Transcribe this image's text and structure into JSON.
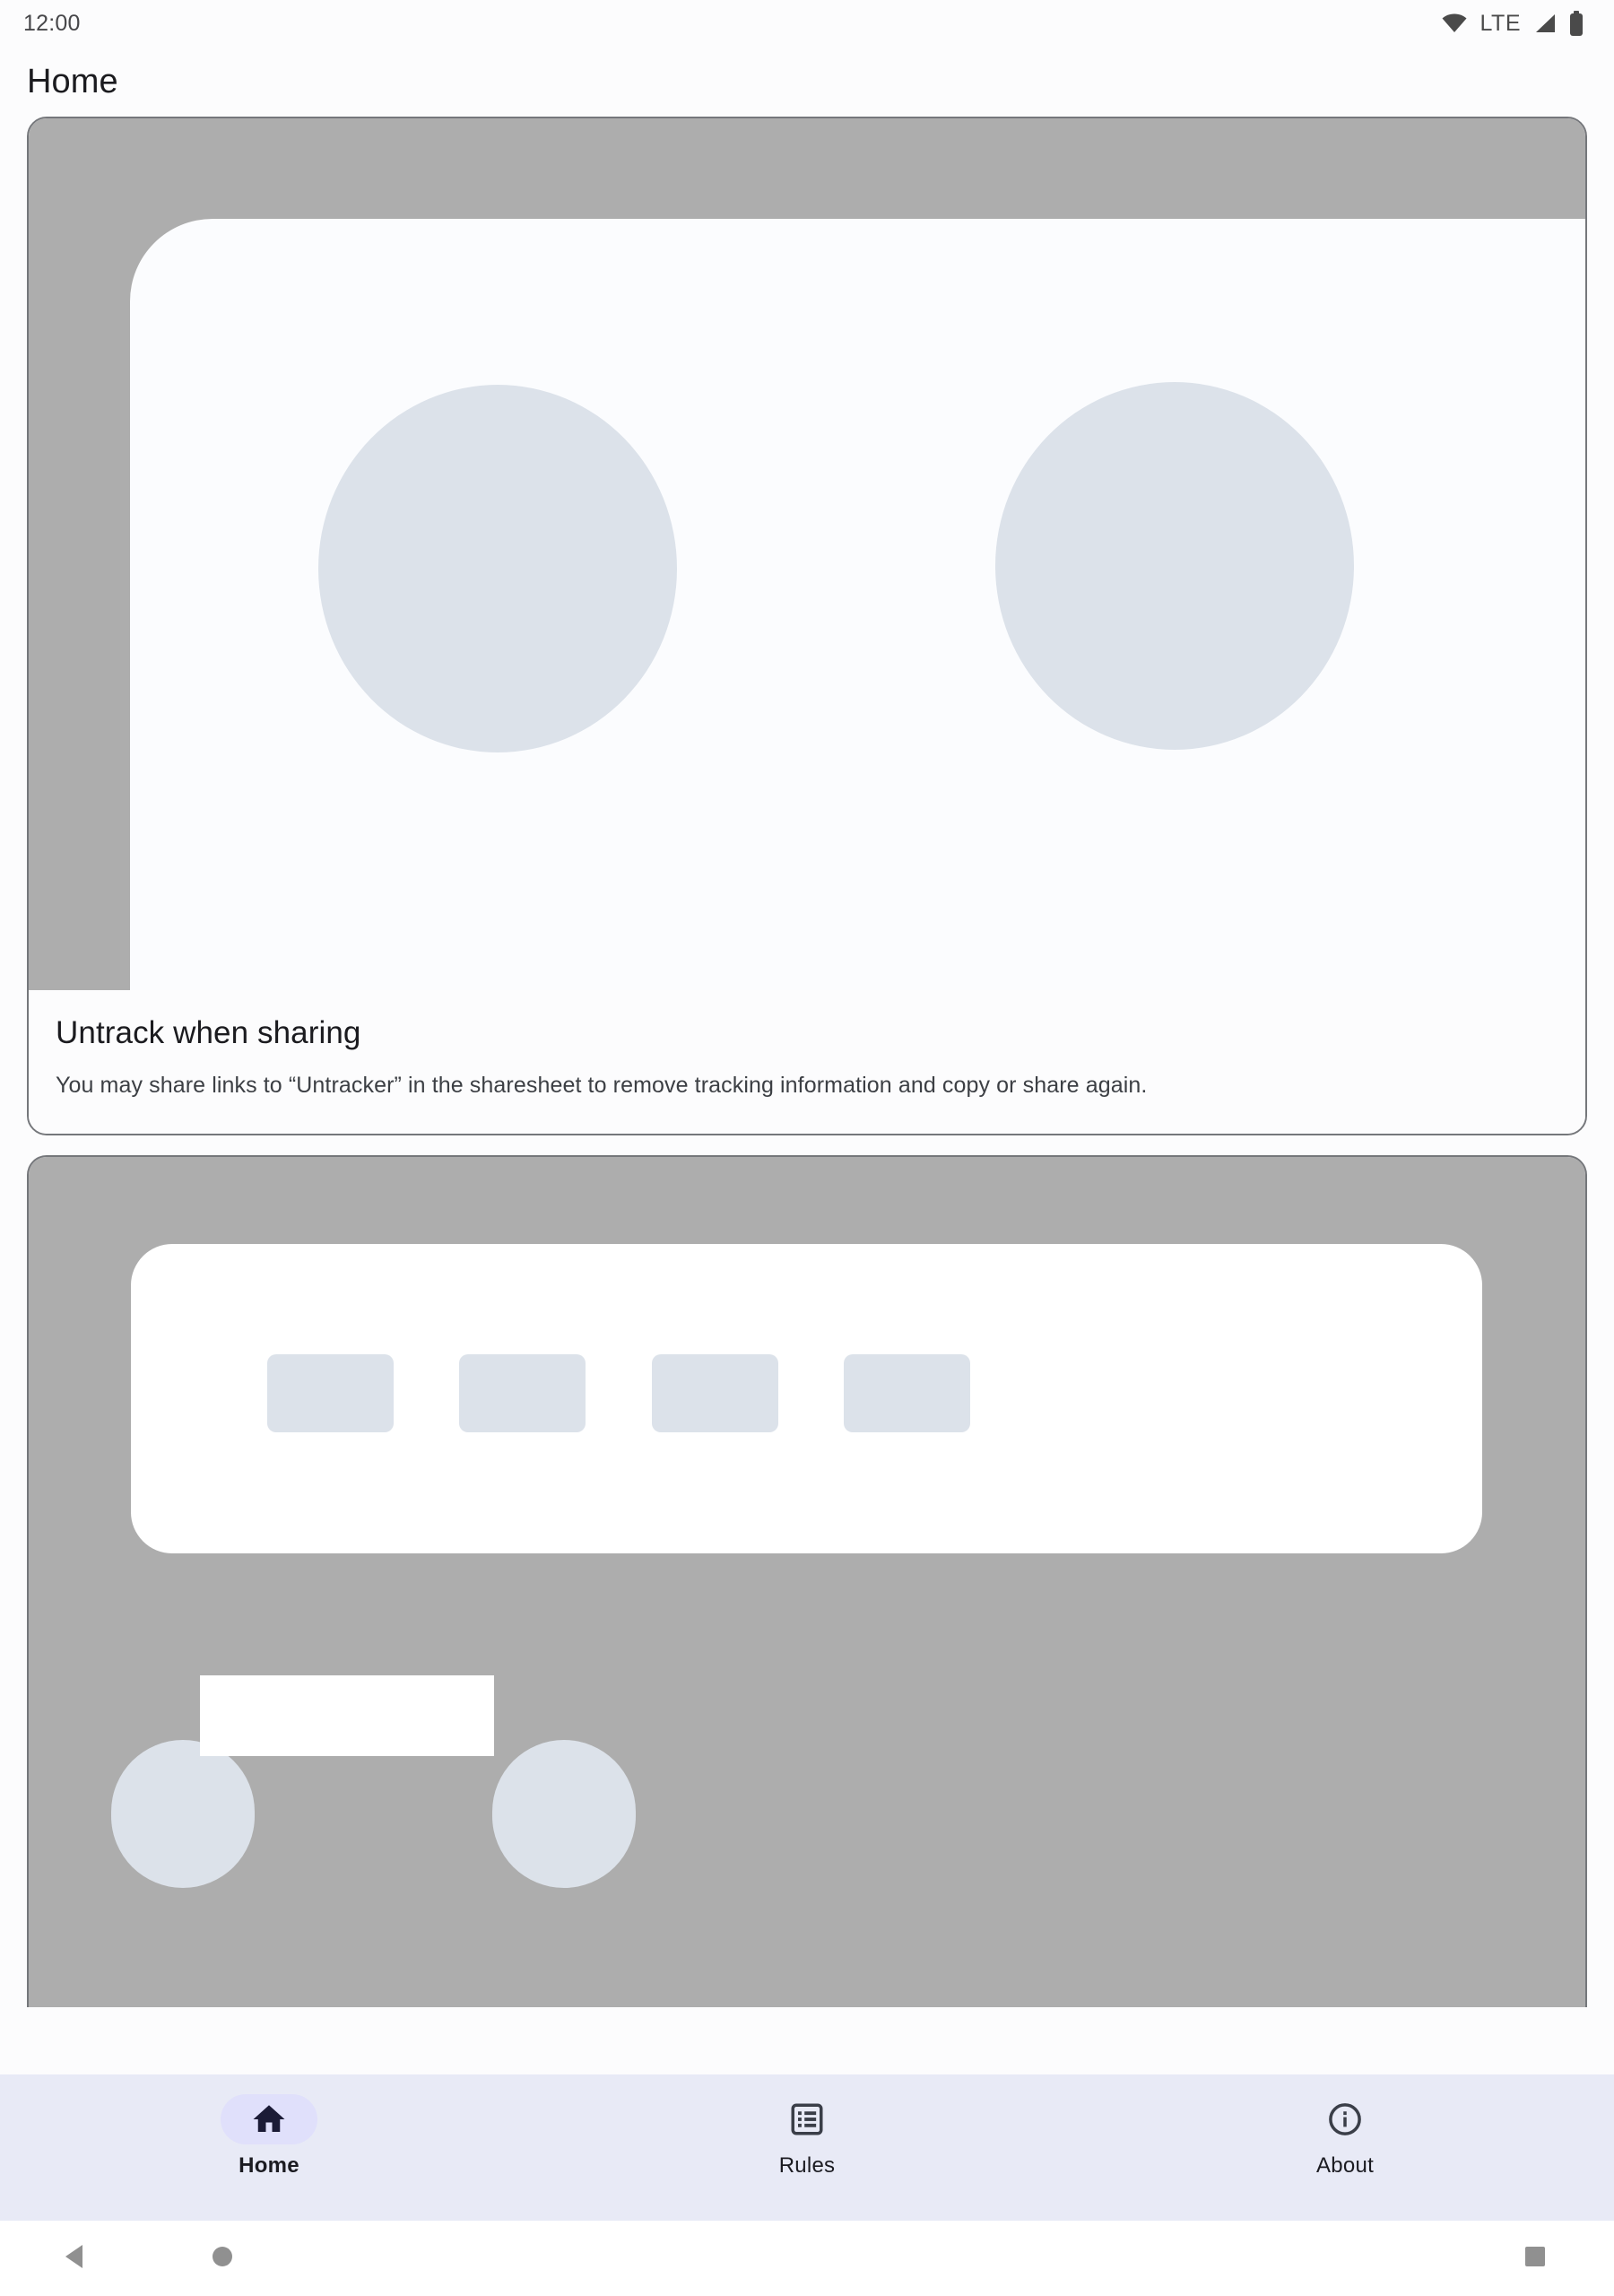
{
  "status_bar": {
    "clock": "12:00",
    "network_label": "LTE",
    "icons": [
      "wifi-icon",
      "signal-icon",
      "battery-icon"
    ]
  },
  "app_bar": {
    "title": "Home"
  },
  "cards": [
    {
      "media": "placeholder-illustration-share-sheet",
      "title": "Untrack when sharing",
      "body": "You may share links to “Untracker” in the sharesheet to remove tracking information and copy or share again."
    },
    {
      "media": "placeholder-illustration-quick-settings",
      "title": "",
      "body": ""
    }
  ],
  "bottom_nav": {
    "items": [
      {
        "label": "Home",
        "icon": "home-icon",
        "active": true
      },
      {
        "label": "Rules",
        "icon": "list-icon",
        "active": false
      },
      {
        "label": "About",
        "icon": "info-icon",
        "active": false
      }
    ]
  },
  "system_nav": {
    "back": "back-triangle-icon",
    "home": "home-circle-icon",
    "recents": "recents-square-icon"
  },
  "colors": {
    "nav_background": "#E8EAF6",
    "nav_active_pill": "#E0E0FB",
    "placeholder_grey": "#ADADAD",
    "placeholder_shape": "#DCE2EA",
    "card_border": "#75777B",
    "text_primary": "#1B1B1F"
  }
}
